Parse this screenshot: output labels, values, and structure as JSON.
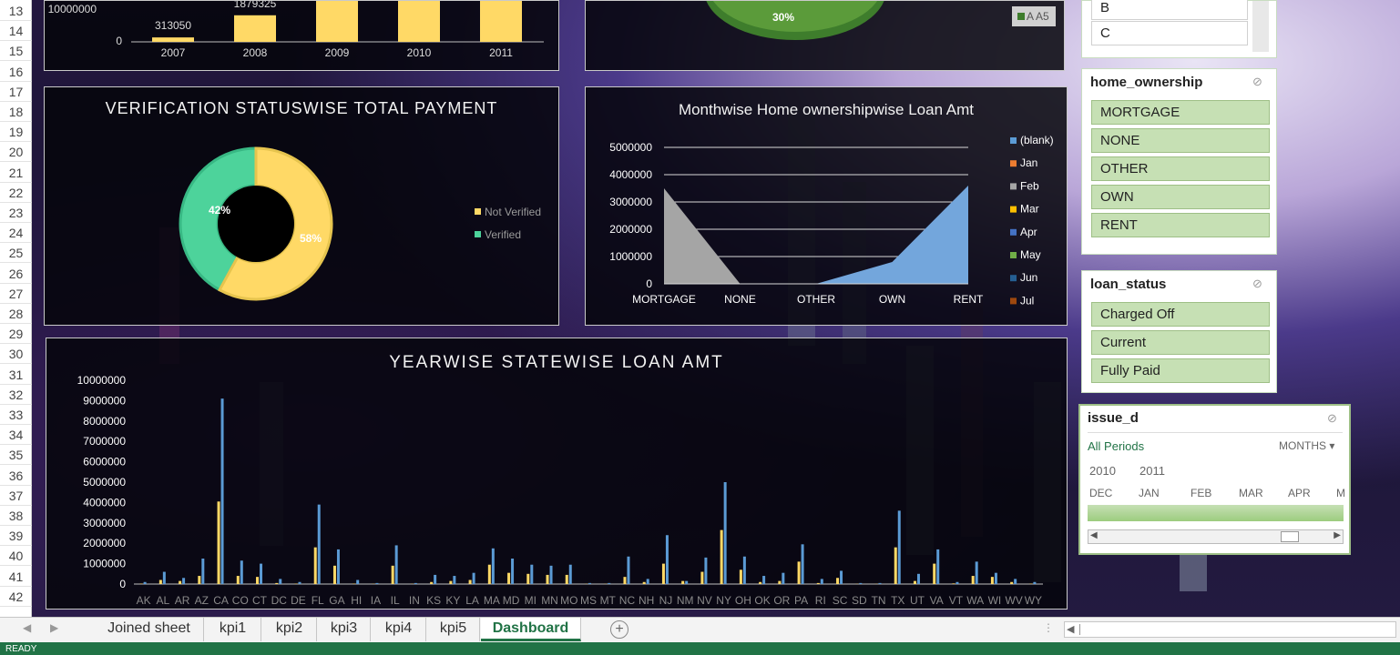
{
  "rows": [
    "13",
    "14",
    "15",
    "16",
    "17",
    "18",
    "19",
    "20",
    "21",
    "22",
    "23",
    "24",
    "25",
    "26",
    "27",
    "28",
    "29",
    "30",
    "31",
    "32",
    "33",
    "34",
    "35",
    "36",
    "37",
    "38",
    "39",
    "40",
    "41",
    "42"
  ],
  "top_chart": {
    "y_top_label": "10000000",
    "y_zero": "0",
    "years": [
      "2007",
      "2008",
      "2009",
      "2010",
      "2011"
    ],
    "labels": [
      "313050",
      "1879325"
    ],
    "values": [
      313050,
      1879325,
      9000000,
      9000000,
      9000000
    ]
  },
  "top_pie": {
    "pct": "30%",
    "legend": "A A5"
  },
  "verification": {
    "title": "VERIFICATION STATUSWISE TOTAL PAYMENT",
    "legend": [
      "Not Verified",
      "Verified"
    ],
    "pct_not_verified": "58%",
    "pct_verified": "42%"
  },
  "home_chart": {
    "title": "Monthwise Home ownershipwise Loan Amt",
    "y_ticks": [
      "5000000",
      "4000000",
      "3000000",
      "2000000",
      "1000000",
      "0"
    ],
    "categories": [
      "MORTGAGE",
      "NONE",
      "OTHER",
      "OWN",
      "RENT"
    ],
    "legend": [
      "(blank)",
      "Jan",
      "Feb",
      "Mar",
      "Apr",
      "May",
      "Jun",
      "Jul"
    ]
  },
  "state_chart": {
    "title": "YEARWISE STATEWISE LOAN AMT",
    "y_ticks": [
      "10000000",
      "9000000",
      "8000000",
      "7000000",
      "6000000",
      "5000000",
      "4000000",
      "3000000",
      "2000000",
      "1000000",
      "0"
    ],
    "states": [
      "AK",
      "AL",
      "AR",
      "AZ",
      "CA",
      "CO",
      "CT",
      "DC",
      "DE",
      "FL",
      "GA",
      "HI",
      "IA",
      "IL",
      "IN",
      "KS",
      "KY",
      "LA",
      "MA",
      "MD",
      "MI",
      "MN",
      "MO",
      "MS",
      "MT",
      "NC",
      "NH",
      "NJ",
      "NM",
      "NV",
      "NY",
      "OH",
      "OK",
      "OR",
      "PA",
      "RI",
      "SC",
      "SD",
      "TN",
      "TX",
      "UT",
      "VA",
      "VT",
      "WA",
      "WI",
      "WV",
      "WY"
    ]
  },
  "chart_data": [
    {
      "type": "bar",
      "title": "",
      "categories": [
        "2007",
        "2008",
        "2009",
        "2010",
        "2011"
      ],
      "values": [
        313050,
        1879325,
        9000000,
        9000000,
        9000000
      ],
      "ylim": [
        0,
        10000000
      ]
    },
    {
      "type": "pie",
      "title": "VERIFICATION STATUSWISE TOTAL PAYMENT",
      "categories": [
        "Not Verified",
        "Verified"
      ],
      "values": [
        58,
        42
      ]
    },
    {
      "type": "area",
      "title": "Monthwise Home ownershipwise Loan Amt",
      "categories": [
        "MORTGAGE",
        "NONE",
        "OTHER",
        "OWN",
        "RENT"
      ],
      "series": [
        {
          "name": "Feb",
          "values": [
            3500000,
            0,
            0,
            0,
            0
          ]
        },
        {
          "name": "(blank)",
          "values": [
            0,
            0,
            0,
            800000,
            3600000
          ]
        }
      ],
      "ylim": [
        0,
        5000000
      ]
    },
    {
      "type": "bar",
      "title": "YEARWISE STATEWISE LOAN AMT",
      "categories": [
        "AK",
        "AL",
        "AR",
        "AZ",
        "CA",
        "CO",
        "CT",
        "DC",
        "DE",
        "FL",
        "GA",
        "HI",
        "IA",
        "IL",
        "IN",
        "KS",
        "KY",
        "LA",
        "MA",
        "MD",
        "MI",
        "MN",
        "MO",
        "MS",
        "MT",
        "NC",
        "NH",
        "NJ",
        "NM",
        "NV",
        "NY",
        "OH",
        "OK",
        "OR",
        "PA",
        "RI",
        "SC",
        "SD",
        "TN",
        "TX",
        "UT",
        "VA",
        "VT",
        "WA",
        "WI",
        "WV",
        "WY"
      ],
      "series": [
        {
          "name": "yellow",
          "values": [
            20000,
            200000,
            150000,
            400000,
            4050000,
            400000,
            350000,
            50000,
            20000,
            1800000,
            900000,
            20000,
            10000,
            900000,
            10000,
            100000,
            150000,
            200000,
            950000,
            550000,
            500000,
            450000,
            450000,
            10000,
            10000,
            350000,
            100000,
            1000000,
            150000,
            600000,
            2650000,
            700000,
            100000,
            150000,
            1100000,
            50000,
            300000,
            10000,
            10000,
            1800000,
            150000,
            1000000,
            30000,
            400000,
            350000,
            100000,
            20000
          ]
        },
        {
          "name": "blue",
          "values": [
            100000,
            600000,
            300000,
            1250000,
            9100000,
            1150000,
            1000000,
            250000,
            100000,
            3900000,
            1700000,
            200000,
            50000,
            1900000,
            50000,
            450000,
            400000,
            550000,
            1750000,
            1250000,
            950000,
            900000,
            950000,
            50000,
            50000,
            1350000,
            250000,
            2400000,
            150000,
            1300000,
            5000000,
            1350000,
            400000,
            550000,
            1950000,
            250000,
            650000,
            50000,
            50000,
            3600000,
            500000,
            1700000,
            100000,
            1100000,
            550000,
            250000,
            100000
          ]
        }
      ],
      "ylim": [
        0,
        10000000
      ]
    }
  ],
  "slicer_home": {
    "title": "home_ownership",
    "items": [
      "MORTGAGE",
      "NONE",
      "OTHER",
      "OWN",
      "RENT"
    ]
  },
  "slicer_loan": {
    "title": "loan_status",
    "items": [
      "Charged Off",
      "Current",
      "Fully Paid"
    ]
  },
  "slicer_top": {
    "items": [
      "B",
      "C"
    ]
  },
  "timeline": {
    "title": "issue_d",
    "all_periods": "All Periods",
    "unit": "MONTHS",
    "years": [
      "2010",
      "2011"
    ],
    "months": [
      "DEC",
      "JAN",
      "FEB",
      "MAR",
      "APR",
      "M"
    ]
  },
  "tabs": [
    "Joined sheet",
    "kpi1",
    "kpi2",
    "kpi3",
    "kpi4",
    "kpi5",
    "Dashboard"
  ],
  "status": "READY",
  "colors": {
    "yellow": "#ffd966",
    "green": "#4dd39b",
    "blue": "#5b9bd5",
    "grey": "#a5a5a5",
    "excel_green": "#217346"
  }
}
